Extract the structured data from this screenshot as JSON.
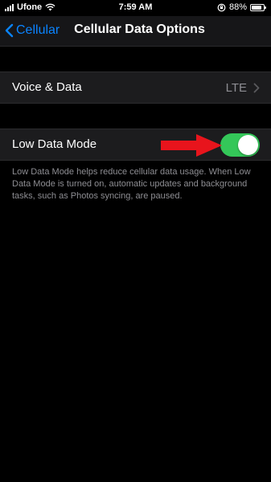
{
  "status_bar": {
    "carrier": "Ufone",
    "time": "7:59 AM",
    "battery_percent": "88%",
    "battery_level": 0.88,
    "icons": [
      "signal-icon",
      "wifi-icon",
      "rotation-lock-icon",
      "battery-icon"
    ]
  },
  "nav": {
    "back_label": "Cellular",
    "title": "Cellular Data Options"
  },
  "rows": {
    "voice_data": {
      "label": "Voice & Data",
      "value": "LTE"
    },
    "low_data_mode": {
      "label": "Low Data Mode",
      "enabled": true
    }
  },
  "footer_text": "Low Data Mode helps reduce cellular data usage. When Low Data Mode is turned on, automatic updates and background tasks, such as Photos syncing, are paused.",
  "colors": {
    "accent": "#0a84ff",
    "toggle_on": "#34c759",
    "annotation_arrow": "#e8141c",
    "background": "#000000",
    "cell": "#1c1c1e",
    "secondary_text": "#8e8e93"
  }
}
